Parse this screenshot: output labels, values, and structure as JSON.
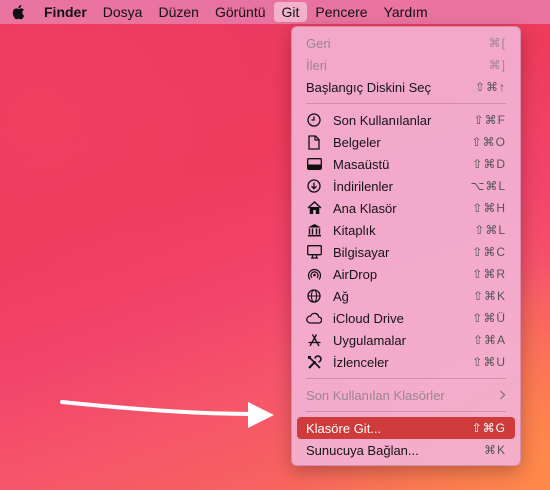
{
  "menubar": {
    "app": "Finder",
    "items": [
      "Dosya",
      "Düzen",
      "Görüntü",
      "Git",
      "Pencere",
      "Yardım"
    ]
  },
  "menu": {
    "nav": [
      {
        "label": "Geri",
        "shortcut": "⌘[",
        "disabled": true
      },
      {
        "label": "İleri",
        "shortcut": "⌘]",
        "disabled": true
      },
      {
        "label": "Başlangıç Diskini Seç",
        "shortcut": "⇧⌘↑",
        "disabled": false
      }
    ],
    "places": [
      {
        "label": "Son Kullanılanlar",
        "shortcut": "⇧⌘F",
        "icon": "clock-icon"
      },
      {
        "label": "Belgeler",
        "shortcut": "⇧⌘O",
        "icon": "document-icon"
      },
      {
        "label": "Masaüstü",
        "shortcut": "⇧⌘D",
        "icon": "desktop-icon"
      },
      {
        "label": "İndirilenler",
        "shortcut": "⌥⌘L",
        "icon": "download-icon"
      },
      {
        "label": "Ana Klasör",
        "shortcut": "⇧⌘H",
        "icon": "home-icon"
      },
      {
        "label": "Kitaplık",
        "shortcut": "⇧⌘L",
        "icon": "library-icon"
      },
      {
        "label": "Bilgisayar",
        "shortcut": "⇧⌘C",
        "icon": "computer-icon"
      },
      {
        "label": "AirDrop",
        "shortcut": "⇧⌘R",
        "icon": "airdrop-icon"
      },
      {
        "label": "Ağ",
        "shortcut": "⇧⌘K",
        "icon": "globe-icon"
      },
      {
        "label": "iCloud Drive",
        "shortcut": "⇧⌘Ü",
        "icon": "cloud-icon"
      },
      {
        "label": "Uygulamalar",
        "shortcut": "⇧⌘A",
        "icon": "applications-icon"
      },
      {
        "label": "İzlenceler",
        "shortcut": "⇧⌘U",
        "icon": "utilities-icon"
      }
    ],
    "recent_folders": {
      "label": "Son Kullanılan Klasörler",
      "disabled": true
    },
    "go_to_folder": {
      "label": "Klasöre Git...",
      "shortcut": "⇧⌘G",
      "highlighted": true
    },
    "connect_server": {
      "label": "Sunucuya Bağlan...",
      "shortcut": "⌘K"
    }
  },
  "colors": {
    "highlight": "#cf3a3a",
    "menu_bg": "#f3b2d4"
  }
}
